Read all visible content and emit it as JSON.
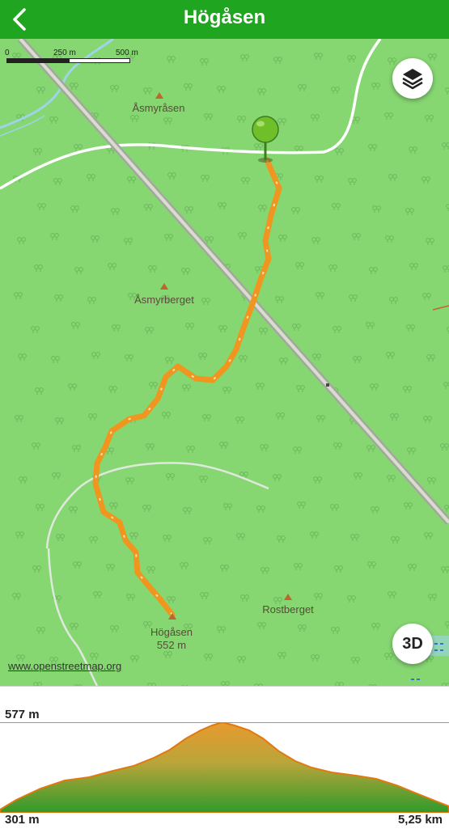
{
  "header": {
    "title": "Högåsen",
    "back_icon": "chevron-left-icon",
    "color": "#1fa51f"
  },
  "map": {
    "scale": {
      "labels": [
        "0",
        "250 m",
        "500 m"
      ]
    },
    "places": [
      {
        "name": "Åsmyråsen"
      },
      {
        "name": "Åsmyrberget"
      },
      {
        "name": "Rostberget"
      },
      {
        "name": "Högåsen",
        "elevation": "552 m"
      }
    ],
    "route_color": "#f0961e",
    "layers_icon": "layers-icon",
    "start_icon": "map-pin-icon",
    "button_3d": "3D",
    "attribution": "www.openstreetmap.org"
  },
  "profile": {
    "toggle_icon": "chevron-down-icon",
    "max_elevation": "577 m",
    "min_elevation": "301 m",
    "distance": "5,25 km"
  }
}
